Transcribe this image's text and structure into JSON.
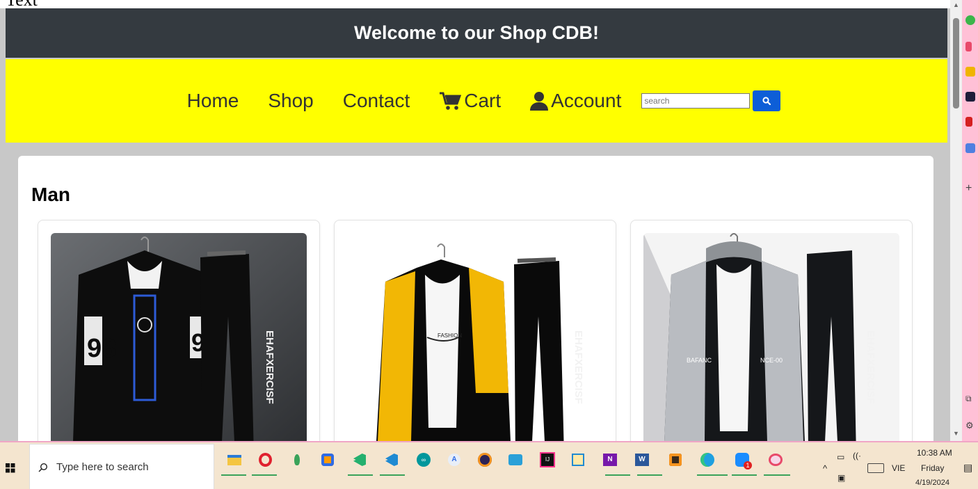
{
  "header": {
    "title": "Welcome to our Shop CDB!"
  },
  "nav": {
    "items": [
      {
        "label": "Home"
      },
      {
        "label": "Shop"
      },
      {
        "label": "Contact"
      },
      {
        "label": "Cart",
        "icon": "cart-icon"
      },
      {
        "label": "Account",
        "icon": "user-icon"
      }
    ],
    "search": {
      "placeholder": "search",
      "value": ""
    },
    "search_button_icon": "search-icon"
  },
  "section": {
    "title": "Man",
    "products": [
      {
        "image": "black-hoodie-tracksuit-98"
      },
      {
        "image": "black-yellow-jacket-tracksuit"
      },
      {
        "image": "grey-black-jacket-tracksuit"
      }
    ]
  },
  "taskbar": {
    "search_placeholder": "Type here to search",
    "language": "VIE",
    "time": "10:38 AM",
    "day": "Friday",
    "date": "4/19/2024",
    "notification_badge": "1"
  },
  "colors": {
    "header_bg": "#343a40",
    "nav_bg": "#ffff00",
    "search_button": "#0d5ed7",
    "page_bg": "#c8c8c8",
    "edge_sidebar": "#ffc0d6",
    "taskbar_bg": "#f4e5cf"
  }
}
